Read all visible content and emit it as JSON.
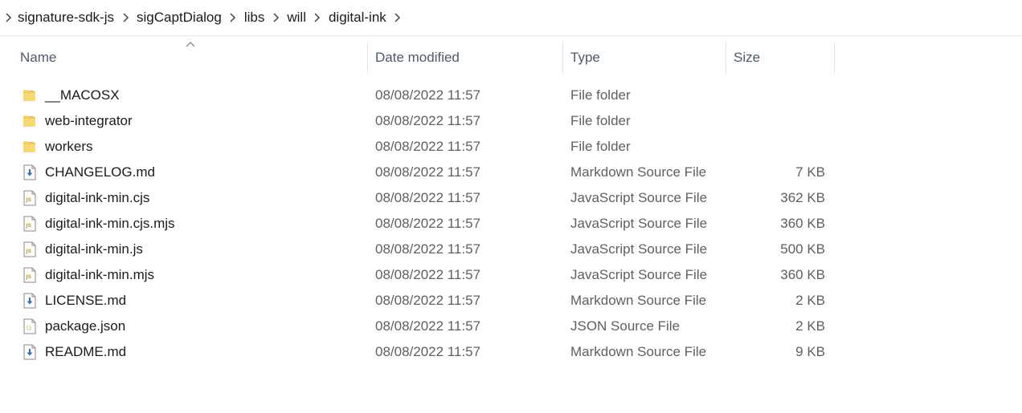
{
  "breadcrumb": [
    "signature-sdk-js",
    "sigCaptDialog",
    "libs",
    "will",
    "digital-ink"
  ],
  "columns": {
    "name": "Name",
    "date": "Date modified",
    "type": "Type",
    "size": "Size"
  },
  "files": [
    {
      "name": "__MACOSX",
      "date": "08/08/2022 11:57",
      "type": "File folder",
      "size": "",
      "icon": "folder-icon"
    },
    {
      "name": "web-integrator",
      "date": "08/08/2022 11:57",
      "type": "File folder",
      "size": "",
      "icon": "folder-icon"
    },
    {
      "name": "workers",
      "date": "08/08/2022 11:57",
      "type": "File folder",
      "size": "",
      "icon": "folder-icon"
    },
    {
      "name": "CHANGELOG.md",
      "date": "08/08/2022 11:57",
      "type": "Markdown Source File",
      "size": "7 KB",
      "icon": "markdown-file-icon"
    },
    {
      "name": "digital-ink-min.cjs",
      "date": "08/08/2022 11:57",
      "type": "JavaScript Source File",
      "size": "362 KB",
      "icon": "js-file-icon"
    },
    {
      "name": "digital-ink-min.cjs.mjs",
      "date": "08/08/2022 11:57",
      "type": "JavaScript Source File",
      "size": "360 KB",
      "icon": "js-file-icon"
    },
    {
      "name": "digital-ink-min.js",
      "date": "08/08/2022 11:57",
      "type": "JavaScript Source File",
      "size": "500 KB",
      "icon": "js-file-icon"
    },
    {
      "name": "digital-ink-min.mjs",
      "date": "08/08/2022 11:57",
      "type": "JavaScript Source File",
      "size": "360 KB",
      "icon": "js-file-icon"
    },
    {
      "name": "LICENSE.md",
      "date": "08/08/2022 11:57",
      "type": "Markdown Source File",
      "size": "2 KB",
      "icon": "markdown-file-icon"
    },
    {
      "name": "package.json",
      "date": "08/08/2022 11:57",
      "type": "JSON Source File",
      "size": "2 KB",
      "icon": "json-file-icon"
    },
    {
      "name": "README.md",
      "date": "08/08/2022 11:57",
      "type": "Markdown Source File",
      "size": "9 KB",
      "icon": "markdown-file-icon"
    }
  ],
  "colors": {
    "folder": "#f8d775",
    "folder_dark": "#e8b443",
    "markdown_arrow": "#2d6ea8",
    "js_label": "#b5a33a",
    "header_text": "#4c5a6b"
  }
}
